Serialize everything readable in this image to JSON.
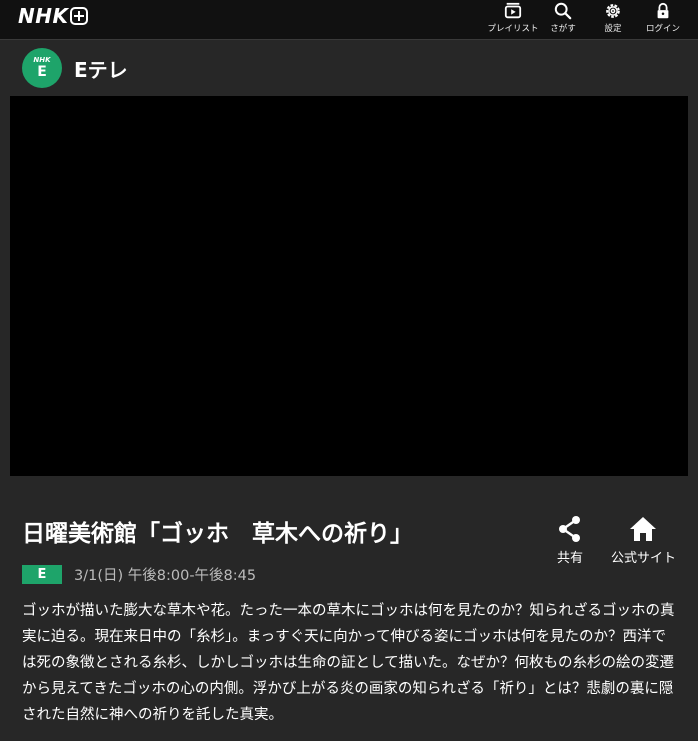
{
  "header": {
    "logo_text": "NHK",
    "nav": [
      {
        "label": "プレイリスト",
        "icon": "playlist-icon"
      },
      {
        "label": "さがす",
        "icon": "search-icon"
      },
      {
        "label": "設定",
        "icon": "gear-icon"
      },
      {
        "label": "ログイン",
        "icon": "lock-icon"
      }
    ]
  },
  "channel": {
    "badge_small": "NHK",
    "badge_letter": "E",
    "name": "Eテレ",
    "color": "#1ea46a"
  },
  "program": {
    "title": "日曜美術館「ゴッホ　草木への祈り」",
    "badge": "E",
    "broadcast_time": "3/1(日) 午後8:00-午後8:45",
    "description": "ゴッホが描いた膨大な草木や花。たった一本の草木にゴッホは何を見たのか？知られざるゴッホの真実に迫る。現在来日中の「糸杉」。まっすぐ天に向かって伸びる姿にゴッホは何を見たのか？西洋では死の象徴とされる糸杉、しかしゴッホは生命の証として描いた。なぜか？何枚もの糸杉の絵の変遷から見えてきたゴッホの心の内側。浮かび上がる炎の画家の知られざる「祈り」とは？悲劇の裏に隠された自然に神への祈りを託した真実。"
  },
  "actions": {
    "share_label": "共有",
    "official_label": "公式サイト"
  }
}
